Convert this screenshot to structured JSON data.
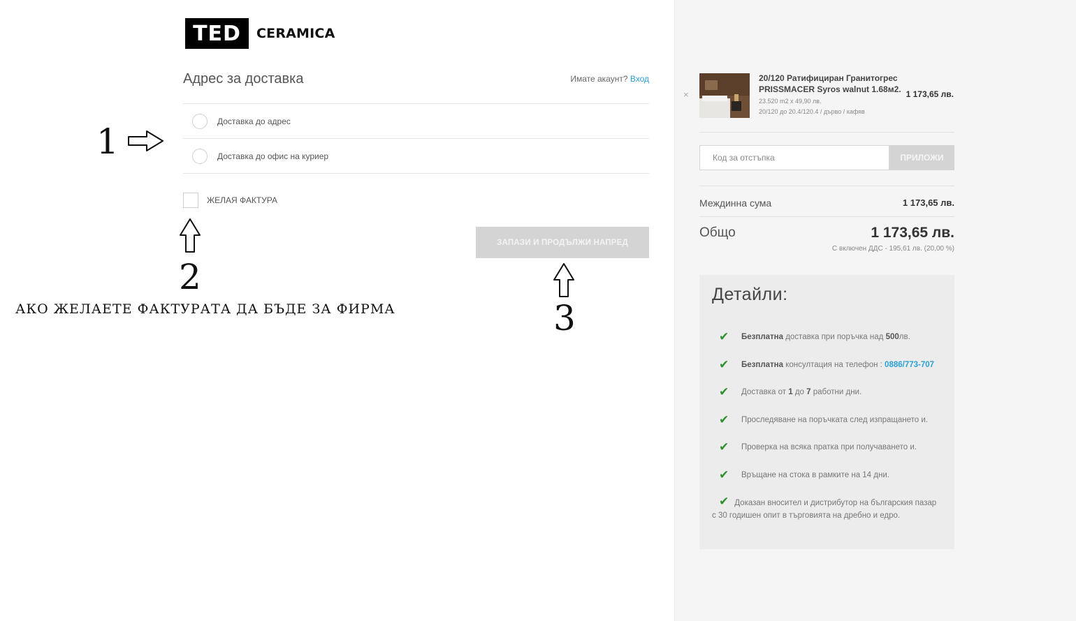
{
  "brand": {
    "logo_mark": "TED",
    "logo_text": "CERAMICA"
  },
  "shipping": {
    "title": "Адрес за доставка",
    "account_prompt": "Имате акаунт?",
    "login_link": "Вход",
    "options": [
      {
        "label": "Доставка до адрес"
      },
      {
        "label": "Доставка до офис на куриер"
      }
    ],
    "invoice_label": "ЖЕЛАЯ ФАКТУРА",
    "save_button": "ЗАПАЗИ И ПРОДЪЛЖИ НАПРЕД"
  },
  "annotations": {
    "n1": "1",
    "n2": "2",
    "n3": "3",
    "note": "АКО ЖЕЛАЕТЕ ФАКТУРАТА ДА БЪДЕ ЗА ФИРМА"
  },
  "cart": {
    "remove_icon": "×",
    "product": {
      "name": "20/120 Ратифициран Гранитогрес PRISSMACER Syros walnut 1.68м2.",
      "qty_line": "23.520 m2 x 49,90 лв.",
      "attr_line": "20/120 до 20.4/120.4 / дърво / кафяв",
      "price": "1 173,65 лв."
    },
    "coupon_placeholder": "Код за отстъпка",
    "apply_button": "ПРИЛОЖИ",
    "subtotal_label": "Междинна сума",
    "subtotal_value": "1 173,65 лв.",
    "total_label": "Общо",
    "total_value": "1 173,65 лв.",
    "vat_note": "С включен ДДС - 195,61 лв. (20,00 %)"
  },
  "details": {
    "title": "Детайли:",
    "free_word": "Безплатна",
    "item1_text": "доставка при поръчка над",
    "item1_amount": "500",
    "item1_unit": "лв.",
    "item2_text": "консултация на телефон :",
    "item2_phone": "0886/773-707",
    "item3_a": "Доставка от",
    "item3_from": "1",
    "item3_b": "до",
    "item3_to": "7",
    "item3_c": "работни дни.",
    "item4": "Проследяване на поръчката след изпращането и.",
    "item5": "Проверка на всяка пратка при получаването и.",
    "item6": "Връщане на стока в рамките на 14 дни.",
    "item7": "Доказан вносител и дистрибутор на българския пазар с 30 годишен опит в търговията на дребно и едро."
  },
  "colors": {
    "accent": "#2aa0d6",
    "check": "#2f8f2f",
    "button_disabled": "#d4d4d4"
  }
}
